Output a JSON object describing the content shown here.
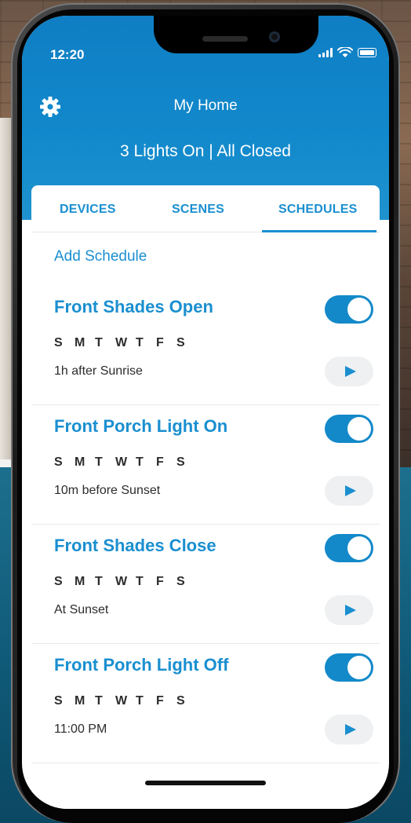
{
  "status_bar": {
    "time": "12:20"
  },
  "header": {
    "title": "My Home",
    "status": "3 Lights On | All Closed"
  },
  "tabs": [
    {
      "label": "DEVICES",
      "selected": false
    },
    {
      "label": "SCENES",
      "selected": false
    },
    {
      "label": "SCHEDULES",
      "selected": true
    }
  ],
  "add_schedule_label": "Add Schedule",
  "schedules": [
    {
      "title": "Front Shades Open",
      "days": [
        "S",
        "M",
        "T",
        "W",
        "T",
        "F",
        "S"
      ],
      "time": "1h after Sunrise",
      "enabled": true
    },
    {
      "title": "Front Porch Light On",
      "days": [
        "S",
        "M",
        "T",
        "W",
        "T",
        "F",
        "S"
      ],
      "time": "10m before Sunset",
      "enabled": true
    },
    {
      "title": "Front Shades Close",
      "days": [
        "S",
        "M",
        "T",
        "W",
        "T",
        "F",
        "S"
      ],
      "time": "At Sunset",
      "enabled": true
    },
    {
      "title": "Front Porch Light Off",
      "days": [
        "S",
        "M",
        "T",
        "W",
        "T",
        "F",
        "S"
      ],
      "time": "11:00 PM",
      "enabled": true
    }
  ],
  "colors": {
    "accent": "#1a8fd0",
    "header_bg": "#1289cc",
    "toggle_on": "#1389c9"
  },
  "icons": {
    "settings": "gear-icon",
    "run": "play-icon"
  }
}
